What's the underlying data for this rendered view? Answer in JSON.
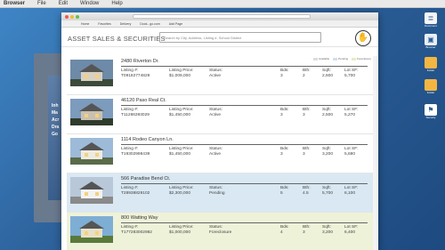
{
  "menubar": {
    "app": "Browser",
    "items": [
      "File",
      "Edit",
      "Window",
      "Help"
    ]
  },
  "bookmarks": [
    "Home",
    "Favorites",
    "Delivery",
    "Dock...go.com",
    "Add Page"
  ],
  "header": {
    "title": "ASSET SALES & SECURITIES",
    "search_placeholder": "Search by City, Address, Listing #, School District"
  },
  "legend": [
    "Available",
    "Pending",
    "Foreclosure"
  ],
  "colors": {
    "pending": "#d9e8f3",
    "foreclosure": "#eef2d9",
    "desktop": "#2f6da8"
  },
  "background_window": {
    "lines": [
      "Inh",
      "Ma",
      "Acr",
      "Dra",
      "Go"
    ]
  },
  "labels": {
    "listing": "Listing #:",
    "price": "Listing Price:",
    "status": "Status:",
    "bds": "Bds:",
    "bth": "Bth:",
    "sqft": "Sqft:",
    "lot": "Lot SF:"
  },
  "listings": [
    {
      "address": "2480 Riverton Dr.",
      "listing": "T09182774829",
      "price": "$1,009,000",
      "status": "Active",
      "bds": "3",
      "bth": "2",
      "sqft": "2,600",
      "lot": "5,700"
    },
    {
      "address": "46120 Paso Real Ct.",
      "listing": "T11286393029",
      "price": "$1,450,000",
      "status": "Active",
      "bds": "3",
      "bth": "3",
      "sqft": "2,500",
      "lot": "5,270"
    },
    {
      "address": "1114 Rodeo Canyon Ln.",
      "listing": "T19302998439",
      "price": "$1,450,000",
      "status": "Active",
      "bds": "3",
      "bth": "3",
      "sqft": "3,200",
      "lot": "5,680"
    },
    {
      "address": "566 Paradise Bend Ct.",
      "listing": "T28938829102",
      "price": "$2,300,000",
      "status": "Pending",
      "bds": "5",
      "bth": "4.5",
      "sqft": "5,700",
      "lot": "6,100"
    },
    {
      "address": "800 Watting Way",
      "listing": "T177283002982",
      "price": "$1,000,000",
      "status": "Foreclosure",
      "bds": "4",
      "bth": "3",
      "sqft": "3,200",
      "lot": "6,400"
    }
  ],
  "dock": [
    "Document",
    "Browser",
    "Folder",
    "Folder",
    "Security"
  ]
}
